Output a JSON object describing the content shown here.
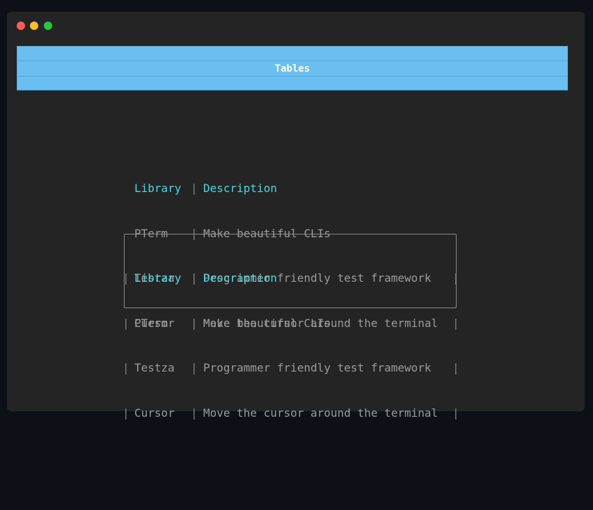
{
  "window": {
    "controls": [
      "close",
      "minimize",
      "maximize"
    ]
  },
  "header": {
    "title": "Tables",
    "color": "#6bbff0"
  },
  "table_plain": {
    "columns": [
      "Library",
      "Description"
    ],
    "separator": "|",
    "rows": [
      [
        "PTerm",
        "Make beautiful CLIs"
      ],
      [
        "Testza",
        "Programmer friendly test framework"
      ],
      [
        "Cursor",
        "Move the cursor around the terminal"
      ]
    ]
  },
  "table_boxed": {
    "columns": [
      "Library",
      "Description"
    ],
    "separator": "|",
    "rows": [
      [
        "PTerm",
        "Make beautiful CLIs"
      ],
      [
        "Testza",
        "Programmer friendly test framework"
      ],
      [
        "Cursor",
        "Move the cursor around the terminal"
      ]
    ]
  },
  "colors": {
    "header_text": "#4fd6e0",
    "body_text": "#9b9b9b",
    "background": "#242424"
  }
}
